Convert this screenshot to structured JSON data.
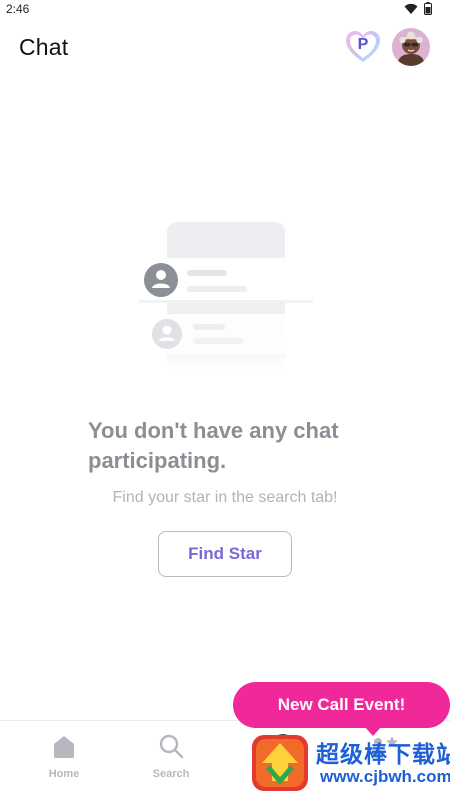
{
  "status_bar": {
    "time": "2:46",
    "icons": [
      "wifi-icon",
      "battery-icon"
    ]
  },
  "header": {
    "title": "Chat",
    "premium_badge_letter": "P"
  },
  "empty_state": {
    "title": "You don't have any chat participating.",
    "subtitle": "Find your star in the search tab!",
    "button_label": "Find Star"
  },
  "call_event": {
    "label": "New Call Event!"
  },
  "bottom_nav": {
    "items": [
      {
        "label": "Home",
        "icon": "home-icon"
      },
      {
        "label": "Search",
        "icon": "search-icon"
      },
      {
        "label": "",
        "icon": "chat-avatar-icon"
      },
      {
        "label": "",
        "icon": "star-icon"
      }
    ]
  },
  "watermark": {
    "text": "超级棒下载站",
    "url": "www.cjbwh.com"
  },
  "colors": {
    "accent": "#7b68d8",
    "pill": "#f0289a",
    "empty_text": "#8a8e95",
    "muted_text": "#b0b3b9",
    "nav_inactive": "#b5b8be"
  }
}
